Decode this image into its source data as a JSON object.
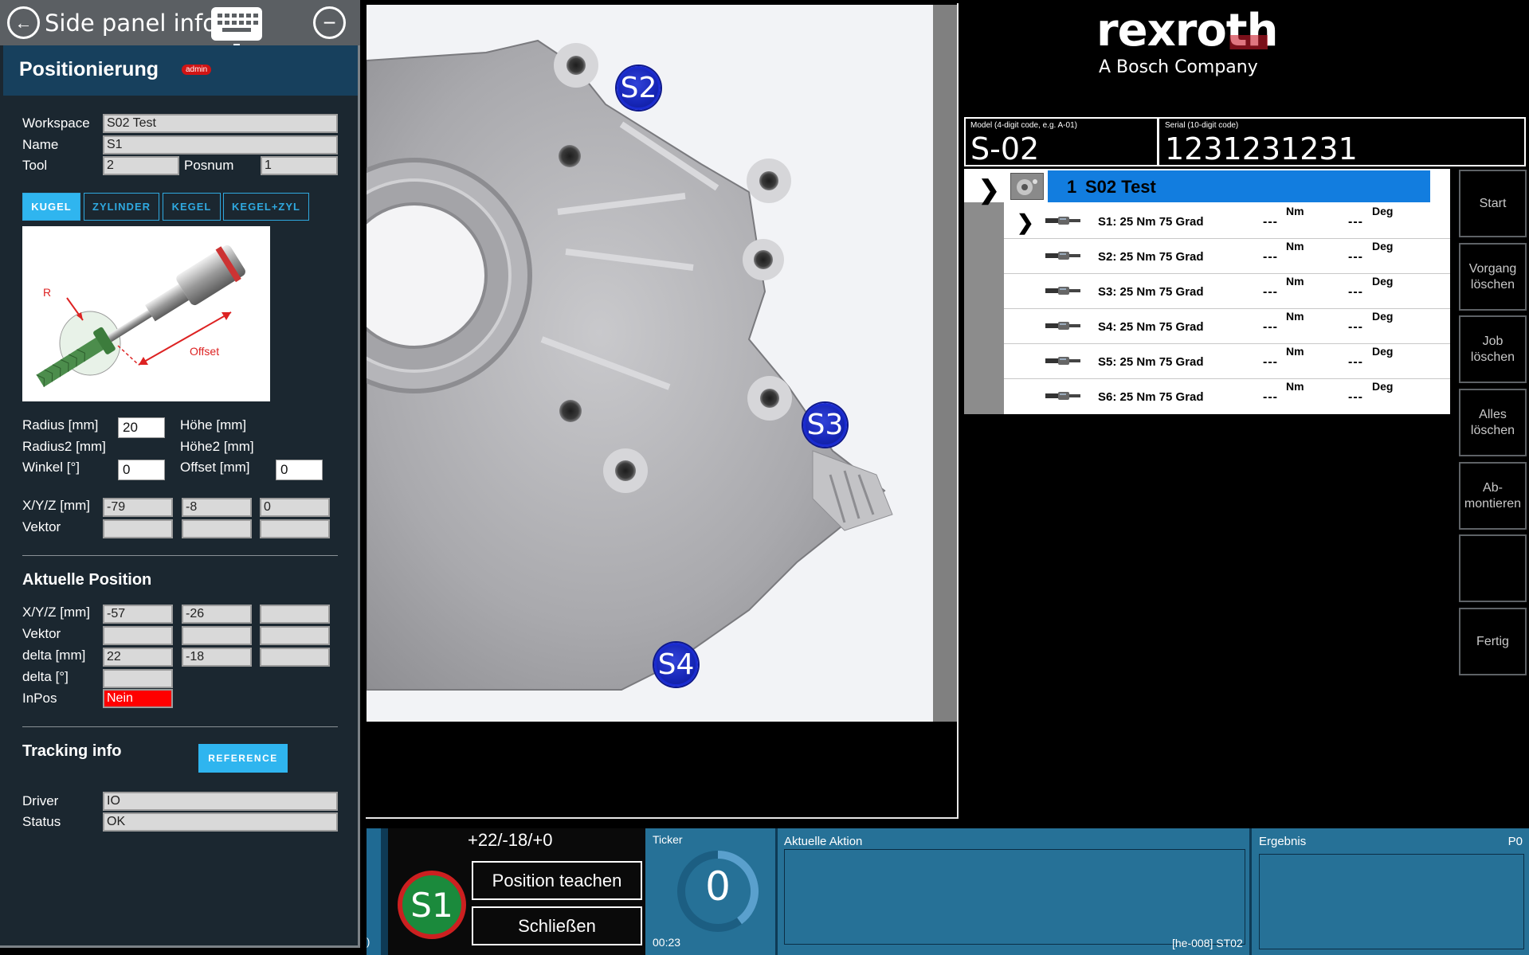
{
  "side_panel": {
    "title": "Side panel inform",
    "section_title": "Positionierung",
    "admin_badge": "admin",
    "workspace_label": "Workspace",
    "workspace_value": "S02 Test",
    "name_label": "Name",
    "name_value": "S1",
    "tool_label": "Tool",
    "tool_value": "2",
    "posnum_label": "Posnum",
    "posnum_value": "1",
    "modes": [
      "KUGEL",
      "ZYLINDER",
      "KEGEL",
      "KEGEL+ZYL"
    ],
    "active_mode": "KUGEL",
    "diagram_r": "R",
    "diagram_offset": "Offset",
    "radius_label": "Radius [mm]",
    "radius_value": "20",
    "hoehe_label": "Höhe [mm]",
    "radius2_label": "Radius2 [mm]",
    "hoehe2_label": "Höhe2 [mm]",
    "winkel_label": "Winkel [°]",
    "winkel_value": "0",
    "offset_label": "Offset [mm]",
    "offset_value": "0",
    "xyz_label": "X/Y/Z [mm]",
    "xyz_values": [
      "-79",
      "-8",
      "0"
    ],
    "vektor_label": "Vektor",
    "current_title": "Aktuelle Position",
    "cur_xyz_label": "X/Y/Z [mm]",
    "cur_xyz_values": [
      "-57",
      "-26",
      ""
    ],
    "cur_vektor_label": "Vektor",
    "delta_mm_label": "delta [mm]",
    "delta_mm_values": [
      "22",
      "-18",
      ""
    ],
    "delta_deg_label": "delta [°]",
    "inpos_label": "InPos",
    "inpos_value": "Nein",
    "tracking_title": "Tracking info",
    "reference_button": "REFERENCE",
    "driver_label": "Driver",
    "driver_value": "IO",
    "status_label": "Status",
    "status_value": "OK"
  },
  "image_pins": [
    "S2",
    "S3",
    "S4"
  ],
  "brand": {
    "name": "rexroth",
    "tagline": "A Bosch Company"
  },
  "model": {
    "label": "Model (4-digit code, e.g. A-01)",
    "value": "S-02"
  },
  "serial": {
    "label": "Serial (10-digit code)",
    "value": "1231231231"
  },
  "job": {
    "number": "1",
    "name": "S02 Test",
    "steps": [
      {
        "label": "S1: 25 Nm 75 Grad",
        "nm": "---",
        "deg": "---"
      },
      {
        "label": "S2: 25 Nm 75 Grad",
        "nm": "---",
        "deg": "---"
      },
      {
        "label": "S3: 25 Nm 75 Grad",
        "nm": "---",
        "deg": "---"
      },
      {
        "label": "S4: 25 Nm 75 Grad",
        "nm": "---",
        "deg": "---"
      },
      {
        "label": "S5: 25 Nm 75 Grad",
        "nm": "---",
        "deg": "---"
      },
      {
        "label": "S6: 25 Nm 75 Grad",
        "nm": "---",
        "deg": "---"
      }
    ],
    "unit_nm": "Nm",
    "unit_deg": "Deg"
  },
  "side_buttons": [
    "Start",
    "Vorgang löschen",
    "Job löschen",
    "Alles löschen",
    "Ab-montieren",
    "",
    "Fertig"
  ],
  "bottom": {
    "delta_text": "+22/-18/+0",
    "current_step": "S1",
    "teach_button": "Position teachen",
    "close_button": "Schließen",
    "ticker_label": "Ticker",
    "ticker_value": "0",
    "ticker_progress": 0.4,
    "ticker_time": "00:23",
    "action_label": "Aktuelle Aktion",
    "action_code": "[he-008] ST02",
    "result_label": "Ergebnis",
    "result_code": "P0",
    "left_edge_text": ")"
  },
  "colors": {
    "accent": "#2fb5ef",
    "selected_job": "#127ddf",
    "inpos_no": "#ff0000",
    "bottom_bar": "#1f6a93",
    "step_ok": "#1b8a3c"
  }
}
